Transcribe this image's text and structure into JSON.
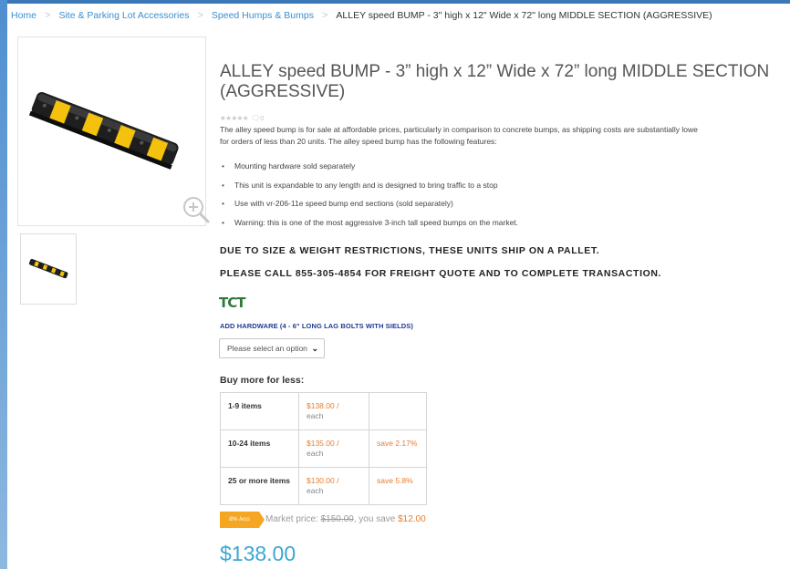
{
  "breadcrumb": {
    "home": "Home",
    "category": "Site & Parking Lot Accessories",
    "subcategory": "Speed Humps & Bumps",
    "current": "ALLEY speed BUMP - 3\" high x 12\" Wide x 72\" long MIDDLE SECTION (AGGRESSIVE)"
  },
  "product": {
    "title": "ALLEY speed BUMP - 3” high x 12” Wide x 72” long MIDDLE SECTION (AGGRESSIVE)",
    "rating_stars": "★★★★★",
    "review_count": "0",
    "description_line1": "The alley speed bump is for sale at affordable prices, particularly in comparison to concrete bumps, as shipping costs are substantially lowe",
    "description_line2": "for orders of less than 20 units. The alley speed bump has the following features:",
    "features": [
      "Mounting hardware sold separately",
      "This unit is expandable to any length and is designed to bring traffic to a stop",
      "Use with vr-206-11e speed bump end sections (sold separately)",
      "Warning: this is one of the most aggressive 3-inch tall speed bumps on the market."
    ],
    "warning1": "DUE TO SIZE & WEIGHT RESTRICTIONS, THESE UNITS SHIP ON A PALLET.",
    "warning2": "PLEASE CALL 855-305-4854 FOR FREIGHT QUOTE AND TO COMPLETE TRANSACTION.",
    "logo_text": "TCT"
  },
  "hardware": {
    "label": "ADD HARDWARE (4 - 6\" LONG LAG BOLTS WITH SIELDS)",
    "placeholder": "Please select an option"
  },
  "tiers": {
    "heading": "Buy more for less:",
    "rows": [
      {
        "qty": "1-9 items",
        "price": "$138.00 /",
        "unit": "each",
        "save": ""
      },
      {
        "qty": "10-24 items",
        "price": "$135.00 /",
        "unit": "each",
        "save": "save 2.17%"
      },
      {
        "qty": "25 or more items",
        "price": "$130.00 /",
        "unit": "each",
        "save": "save 5.8%"
      }
    ]
  },
  "pricing": {
    "badge": "8% less",
    "market_label": "Market price: ",
    "market_price": "$150.00",
    "you_save_label": ", you save ",
    "you_save": "$12.00",
    "price": "$138.00"
  },
  "colors": {
    "link": "#3a8fd0",
    "accent_orange": "#e87d2e",
    "price_blue": "#3aa7d4",
    "badge": "#f5a623",
    "hardware_label": "#1f3a93"
  }
}
